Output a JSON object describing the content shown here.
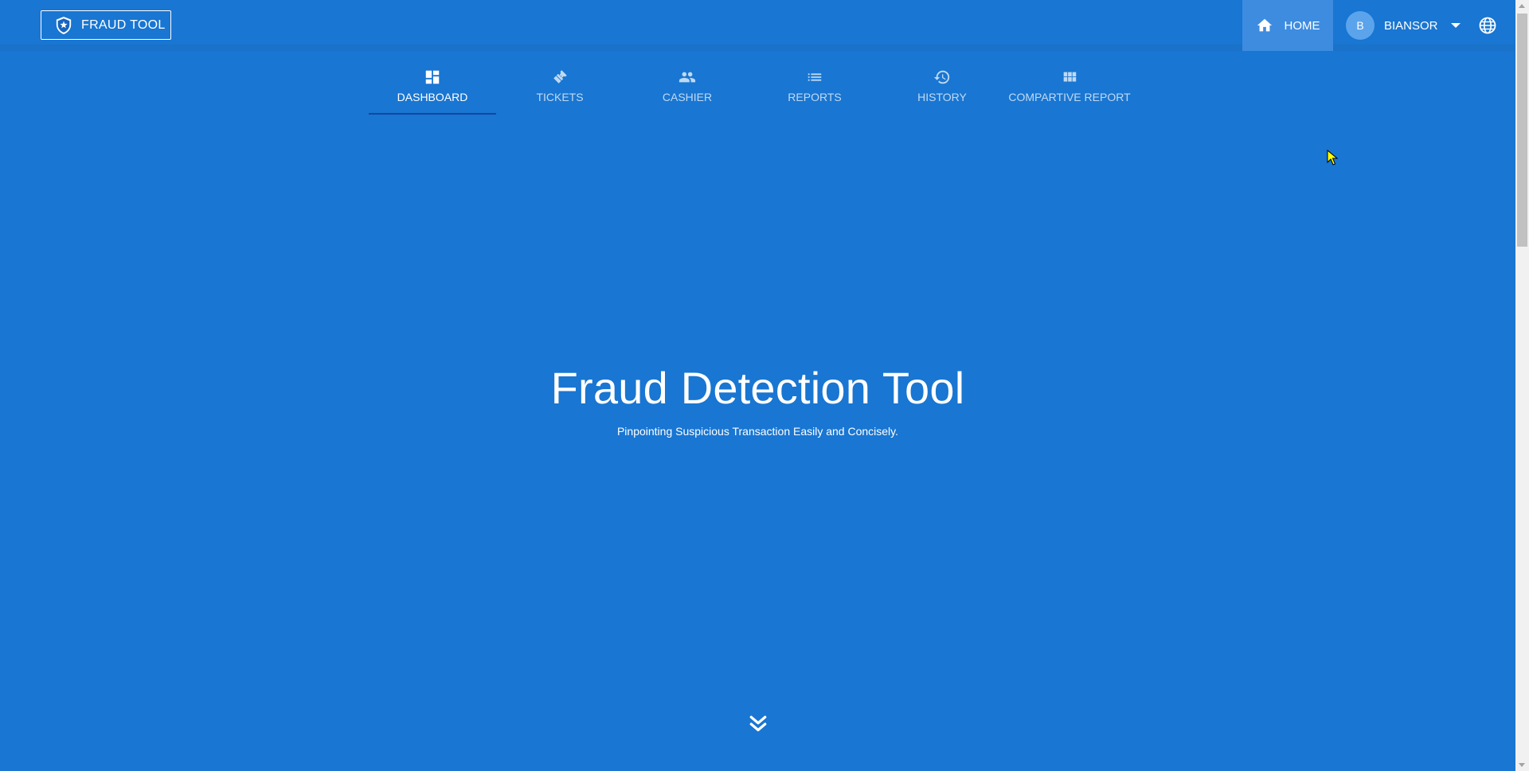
{
  "brand": {
    "label": "FRAUD TOOL",
    "icon": "shield-icon"
  },
  "header": {
    "home_label": "HOME",
    "user": {
      "initial": "B",
      "name": "BIANSOR"
    }
  },
  "tabs": [
    {
      "label": "DASHBOARD",
      "icon": "dashboard-icon",
      "active": true
    },
    {
      "label": "TICKETS",
      "icon": "ticket-icon",
      "active": false
    },
    {
      "label": "CASHIER",
      "icon": "people-icon",
      "active": false
    },
    {
      "label": "REPORTS",
      "icon": "list-icon",
      "active": false
    },
    {
      "label": "HISTORY",
      "icon": "history-icon",
      "active": false
    },
    {
      "label": "COMPARTIVE REPORT",
      "icon": "grid-icon",
      "active": false
    }
  ],
  "hero": {
    "title": "Fraud Detection Tool",
    "subtitle": "Pinpointing Suspicious Transaction Easily and Concisely."
  },
  "colors": {
    "background": "#1976d2",
    "active_tab_indicator": "#0d47a1",
    "home_highlight": "#3d8ce0"
  }
}
